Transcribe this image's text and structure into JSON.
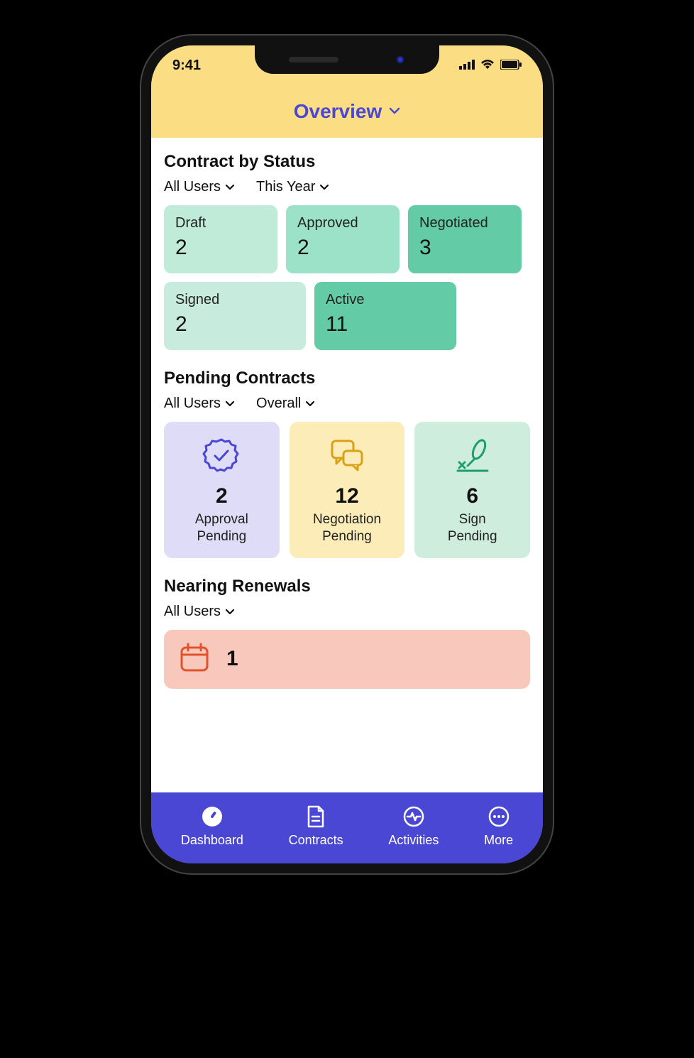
{
  "statusbar": {
    "time": "9:41"
  },
  "header": {
    "title": "Overview"
  },
  "sections": {
    "contractByStatus": {
      "title": "Contract by Status",
      "filters": {
        "users": "All Users",
        "period": "This Year"
      },
      "cards": [
        {
          "label": "Draft",
          "count": "2",
          "color": "#BFEBD8"
        },
        {
          "label": "Approved",
          "count": "2",
          "color": "#9CE2C8"
        },
        {
          "label": "Negotiated",
          "count": "3",
          "color": "#63CBA5"
        },
        {
          "label": "Signed",
          "count": "2",
          "color": "#C7ECDD",
          "wide": true
        },
        {
          "label": "Active",
          "count": "11",
          "color": "#63CBA5",
          "wide": true
        }
      ]
    },
    "pendingContracts": {
      "title": "Pending Contracts",
      "filters": {
        "users": "All Users",
        "period": "Overall"
      },
      "cards": [
        {
          "count": "2",
          "label": "Approval Pending",
          "bg": "#DEDCF7",
          "icon": "approval"
        },
        {
          "count": "12",
          "label": "Negotiation Pending",
          "bg": "#FCECB7",
          "icon": "negotiation"
        },
        {
          "count": "6",
          "label": "Sign Pending",
          "bg": "#CFEDDD",
          "icon": "sign"
        }
      ]
    },
    "nearingRenewals": {
      "title": "Nearing Renewals",
      "filters": {
        "users": "All Users"
      },
      "count": "1"
    }
  },
  "nav": {
    "items": [
      {
        "label": "Dashboard",
        "icon": "dashboard"
      },
      {
        "label": "Contracts",
        "icon": "contracts"
      },
      {
        "label": "Activities",
        "icon": "activities"
      },
      {
        "label": "More",
        "icon": "more"
      }
    ]
  }
}
